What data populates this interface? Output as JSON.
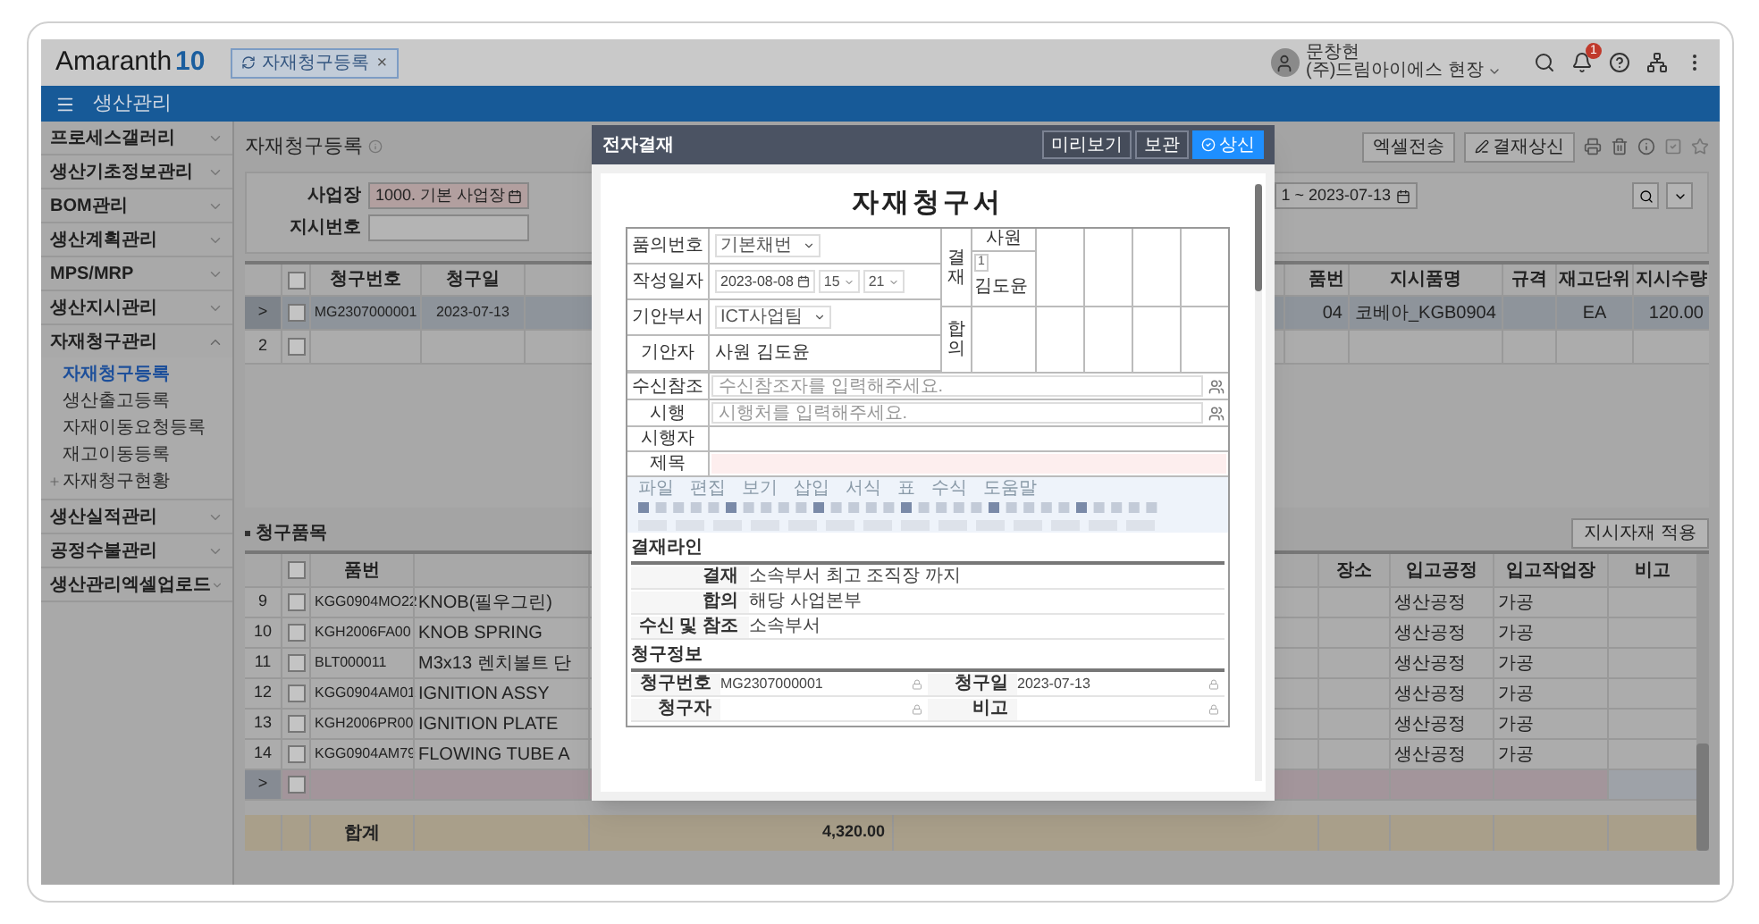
{
  "header": {
    "logo_text": "Amaranth",
    "logo_version": "10",
    "tab": {
      "label": "자재청구등록",
      "close": "×"
    },
    "user": {
      "name": "문창현",
      "org": "(주)드림아이에스 현장"
    },
    "notification_count": "1"
  },
  "module_bar": {
    "title": "생산관리"
  },
  "sidebar": {
    "items": [
      {
        "label": "프로세스갤러리",
        "expanded": false
      },
      {
        "label": "생산기초정보관리",
        "expanded": false
      },
      {
        "label": "BOM관리",
        "expanded": false
      },
      {
        "label": "생산계획관리",
        "expanded": false
      },
      {
        "label": "MPS/MRP",
        "expanded": false
      },
      {
        "label": "생산지시관리",
        "expanded": false
      },
      {
        "label": "자재청구관리",
        "expanded": true,
        "children": [
          {
            "label": "자재청구등록",
            "kind": "page",
            "selected": true
          },
          {
            "label": "생산출고등록",
            "kind": "page",
            "selected": false
          },
          {
            "label": "자재이동요청등록",
            "kind": "page",
            "selected": false
          },
          {
            "label": "재고이동등록",
            "kind": "page",
            "selected": false
          },
          {
            "label": "자재청구현황",
            "kind": "folder",
            "selected": false
          }
        ]
      },
      {
        "label": "생산실적관리",
        "expanded": false
      },
      {
        "label": "공정수불관리",
        "expanded": false
      },
      {
        "label": "생산관리엑셀업로드",
        "expanded": false
      }
    ]
  },
  "page": {
    "title": "자재청구등록",
    "actions": [
      "엑셀전송",
      "결재상신"
    ]
  },
  "search": {
    "fields": [
      {
        "label": "사업장",
        "value": "1000. 기본 사업장"
      },
      {
        "label": "지시번호"
      }
    ],
    "date_range": "1 ~ 2023-07-13"
  },
  "top_grid": {
    "all_checked": false,
    "columns": [
      "청구번호",
      "청구일",
      null,
      "품번",
      "지시품명",
      "규격",
      "재고단위",
      "지시수량"
    ],
    "rows": [
      {
        "row_header": ">",
        "selected": true,
        "checked": false,
        "cells": [
          "MG2307000001",
          "2023-07-13",
          null,
          "04",
          "코베아_KGB0904",
          null,
          "EA",
          "120.00"
        ]
      },
      {
        "row_header": "2",
        "selected": false,
        "checked": false,
        "cells": [
          null,
          null,
          null,
          null,
          null,
          null,
          null,
          null
        ]
      }
    ]
  },
  "items_grid": {
    "title": "청구품목",
    "apply_button": "지시자재 적용",
    "all_checked": false,
    "columns": [
      "품번",
      null,
      null,
      null,
      "장소",
      "입고공정",
      "입고작업장",
      "비고"
    ],
    "rows": [
      {
        "row_header": "9",
        "selected": false,
        "checked": false,
        "cells": [
          "KGG0904MO22",
          "KNOB(필우그린)",
          null,
          null,
          null,
          "생산공정",
          "가공",
          null
        ]
      },
      {
        "row_header": "10",
        "selected": false,
        "checked": false,
        "cells": [
          "KGH2006FA00",
          "KNOB SPRING",
          null,
          null,
          null,
          "생산공정",
          "가공",
          null
        ]
      },
      {
        "row_header": "11",
        "selected": false,
        "checked": false,
        "cells": [
          "BLT000011",
          "M3x13 렌치볼트 단",
          null,
          null,
          null,
          "생산공정",
          "가공",
          null
        ]
      },
      {
        "row_header": "12",
        "selected": false,
        "checked": false,
        "cells": [
          "KGG0904AM01",
          "IGNITION ASSY",
          null,
          null,
          null,
          "생산공정",
          "가공",
          null
        ]
      },
      {
        "row_header": "13",
        "selected": false,
        "checked": false,
        "cells": [
          "KGH2006PR00",
          "IGNITION PLATE",
          null,
          null,
          null,
          "생산공정",
          "가공",
          null
        ]
      },
      {
        "row_header": "14",
        "selected": false,
        "checked": false,
        "cells": [
          "KGG0904AM79",
          "FLOWING TUBE A",
          null,
          null,
          null,
          "생산공정",
          "가공",
          null
        ]
      },
      {
        "row_header": ">",
        "selected": true,
        "checked": false,
        "cells": [
          null,
          null,
          null,
          null,
          null,
          null,
          null,
          null
        ]
      }
    ],
    "total": {
      "label": "합계",
      "value": "4,320.00"
    }
  },
  "approval_dialog": {
    "title": "전자결재",
    "buttons": [
      {
        "label": "미리보기",
        "kind": "outline"
      },
      {
        "label": "보관",
        "kind": "outline"
      },
      {
        "label": "상신",
        "kind": "primary"
      }
    ],
    "document": {
      "title": "자재청구서",
      "fields": [
        {
          "label": "품의번호",
          "kind": "select",
          "value": "기본채번"
        },
        {
          "label": "작성일자",
          "kind": "datetime",
          "value": "2023-08-08",
          "hour": "15",
          "minute": "21"
        },
        {
          "label": "기안부서",
          "kind": "select",
          "value": "ICT사업팀"
        },
        {
          "label": "기안자",
          "kind": "text",
          "value": "사원 김도윤"
        }
      ],
      "approval": {
        "label": "결재",
        "position": "사원",
        "step": "1",
        "approver": "김도윤"
      },
      "agreement": {
        "label": "합의"
      },
      "recipients": [
        {
          "label": "수신참조",
          "placeholder": "수신참조자를 입력해주세요."
        },
        {
          "label": "시행",
          "placeholder": "시행처를 입력해주세요."
        }
      ],
      "executor": {
        "label": "시행자"
      },
      "subject": {
        "label": "제목"
      },
      "editor_menu": [
        "파일",
        "편집",
        "보기",
        "삽입",
        "서식",
        "표",
        "수식",
        "도움말"
      ],
      "sections": [
        {
          "title": "결재라인",
          "kind": "rows",
          "fields": [
            {
              "label": "결재",
              "value": "소속부서 최고 조직장 까지"
            },
            {
              "label": "합의",
              "value": "해당 사업본부"
            },
            {
              "label": "수신 및 참조",
              "value": "소속부서"
            }
          ]
        },
        {
          "title": "청구정보",
          "kind": "pairs",
          "fields": [
            {
              "label": "청구번호",
              "value": "MG2307000001"
            },
            {
              "label": "청구일",
              "value": "2023-07-13"
            },
            {
              "label": "청구자"
            },
            {
              "label": "비고"
            }
          ]
        }
      ]
    }
  }
}
